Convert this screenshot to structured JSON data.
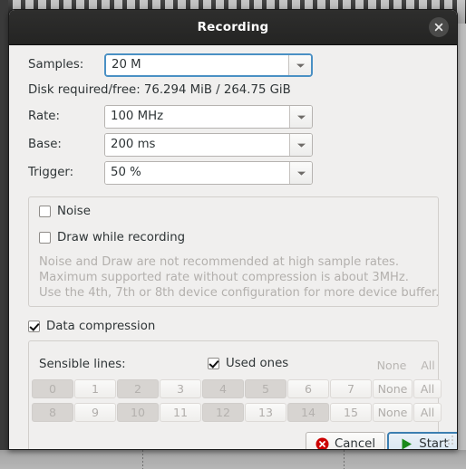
{
  "window": {
    "title": "Recording",
    "close_icon": "close-icon"
  },
  "form": {
    "rows": [
      {
        "label": "Samples:",
        "value": "20 M",
        "focused": true
      },
      {
        "label": "Rate:",
        "value": "100 MHz",
        "focused": false
      },
      {
        "label": "Base:",
        "value": "200 ms",
        "focused": false
      },
      {
        "label": "Trigger:",
        "value": "50 %",
        "focused": false
      }
    ],
    "disk_info": "Disk required/free: 76.294 MiB / 264.75 GiB"
  },
  "options": {
    "noise": {
      "label": "Noise",
      "checked": false
    },
    "draw_while_recording": {
      "label": "Draw while recording",
      "checked": false
    },
    "hints": [
      "Noise and Draw are not recommended at high sample rates.",
      "Maximum supported rate without compression is about 3MHz.",
      "Use the 4th, 7th or 8th device configuration for more device buffer."
    ]
  },
  "compression": {
    "label": "Data compression",
    "checked": true
  },
  "sensible_lines": {
    "label": "Sensible lines:",
    "used_ones": {
      "label": "Used ones",
      "checked": true
    },
    "header_none": "None",
    "header_all": "All",
    "rows": [
      {
        "cells": [
          {
            "label": "0",
            "pressed": true
          },
          {
            "label": "1",
            "pressed": false
          },
          {
            "label": "2",
            "pressed": true
          },
          {
            "label": "3",
            "pressed": false
          },
          {
            "label": "4",
            "pressed": true
          },
          {
            "label": "5",
            "pressed": true
          },
          {
            "label": "6",
            "pressed": false
          },
          {
            "label": "7",
            "pressed": false
          }
        ],
        "none": "None",
        "all": "All"
      },
      {
        "cells": [
          {
            "label": "8",
            "pressed": true
          },
          {
            "label": "9",
            "pressed": false
          },
          {
            "label": "10",
            "pressed": true
          },
          {
            "label": "11",
            "pressed": false
          },
          {
            "label": "12",
            "pressed": true
          },
          {
            "label": "13",
            "pressed": false
          },
          {
            "label": "14",
            "pressed": true
          },
          {
            "label": "15",
            "pressed": false
          }
        ],
        "none": "None",
        "all": "All"
      }
    ]
  },
  "actions": {
    "cancel": {
      "label": "Cancel",
      "icon": "cancel-icon",
      "icon_color": "#cc0000"
    },
    "start": {
      "label": "Start",
      "icon": "play-icon",
      "icon_color": "#1a8a1a"
    }
  }
}
